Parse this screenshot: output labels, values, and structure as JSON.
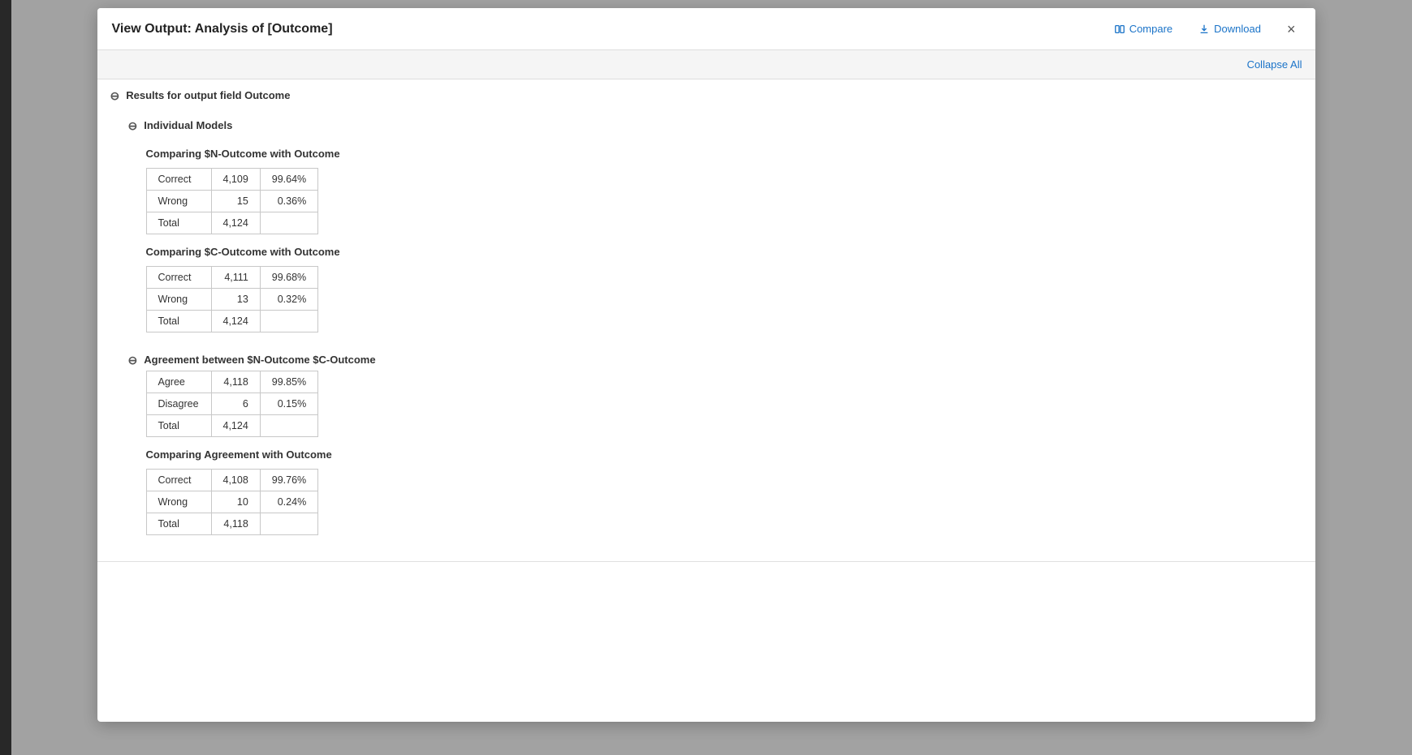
{
  "header": {
    "title": "View Output: Analysis of [Outcome]",
    "compare_label": "Compare",
    "download_label": "Download",
    "close_label": "×"
  },
  "toolbar": {
    "collapse_all_label": "Collapse All"
  },
  "results_section": {
    "label": "Results for output field Outcome",
    "individual_models": {
      "label": "Individual Models",
      "table1": {
        "title": "Comparing $N-Outcome with Outcome",
        "rows": [
          {
            "label": "Correct",
            "count": "4,109",
            "pct": "99.64%"
          },
          {
            "label": "Wrong",
            "count": "15",
            "pct": "0.36%"
          },
          {
            "label": "Total",
            "count": "4,124",
            "pct": ""
          }
        ]
      },
      "table2": {
        "title": "Comparing $C-Outcome with Outcome",
        "rows": [
          {
            "label": "Correct",
            "count": "4,111",
            "pct": "99.68%"
          },
          {
            "label": "Wrong",
            "count": "13",
            "pct": "0.32%"
          },
          {
            "label": "Total",
            "count": "4,124",
            "pct": ""
          }
        ]
      }
    },
    "agreement_section": {
      "label": "Agreement between $N-Outcome $C-Outcome",
      "table1": {
        "title": "",
        "rows": [
          {
            "label": "Agree",
            "count": "4,118",
            "pct": "99.85%"
          },
          {
            "label": "Disagree",
            "count": "6",
            "pct": "0.15%"
          },
          {
            "label": "Total",
            "count": "4,124",
            "pct": ""
          }
        ]
      },
      "table2": {
        "title": "Comparing Agreement with Outcome",
        "rows": [
          {
            "label": "Correct",
            "count": "4,108",
            "pct": "99.76%"
          },
          {
            "label": "Wrong",
            "count": "10",
            "pct": "0.24%"
          },
          {
            "label": "Total",
            "count": "4,118",
            "pct": ""
          }
        ]
      }
    }
  }
}
